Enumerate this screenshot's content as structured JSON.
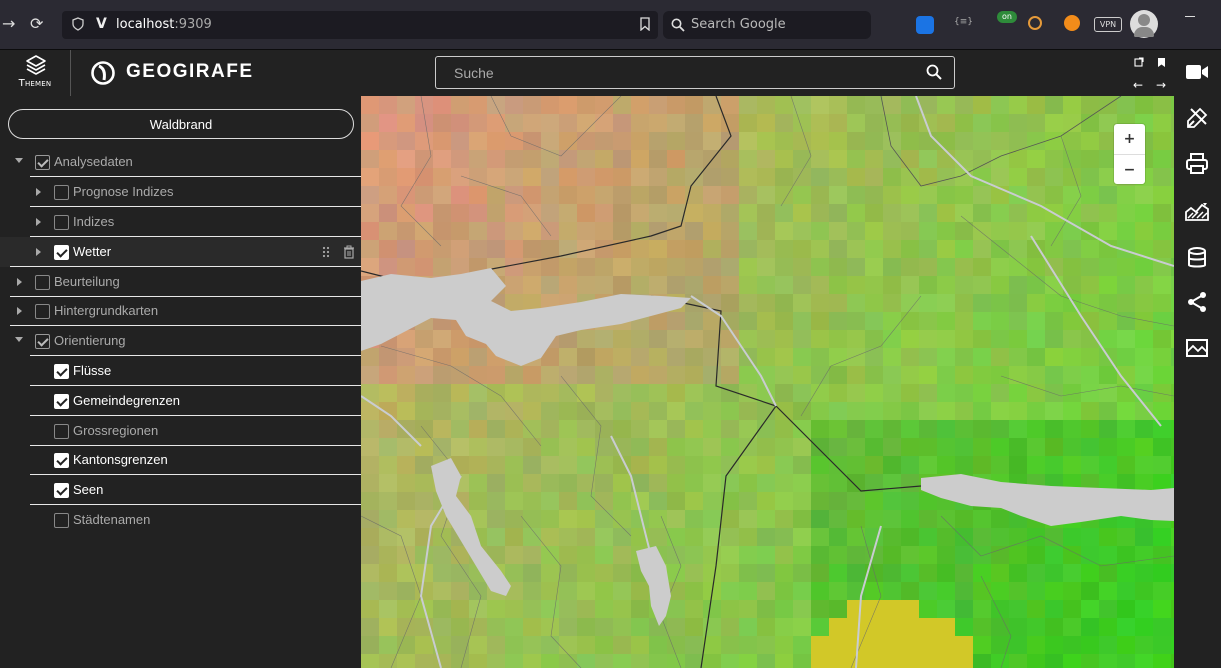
{
  "browser": {
    "url_host": "localhost",
    "url_port": ":9309",
    "search_placeholder": "Search Google",
    "ext_badge": "on",
    "ext_vpn": "VPN",
    "ext_code": "{≡}"
  },
  "header": {
    "themes_label": "Themen",
    "brand_name": "GEOGIRAFE",
    "search_placeholder": "Suche"
  },
  "sidebar": {
    "theme_button": "Waldbrand",
    "layers": [
      {
        "label": "Analysedaten"
      },
      {
        "label": "Prognose Indizes"
      },
      {
        "label": "Indizes"
      },
      {
        "label": "Wetter"
      },
      {
        "label": "Beurteilung"
      },
      {
        "label": "Hintergrundkarten"
      },
      {
        "label": "Orientierung"
      },
      {
        "label": "Flüsse"
      },
      {
        "label": "Gemeindegrenzen"
      },
      {
        "label": "Grossregionen"
      },
      {
        "label": "Kantonsgrenzen"
      },
      {
        "label": "Seen"
      },
      {
        "label": "Städtenamen"
      }
    ]
  },
  "map": {
    "zoom_in": "+",
    "zoom_out": "−"
  },
  "colors": {
    "accent": "#ffffff",
    "panel_bg": "#222222",
    "lake": "#cccccc"
  }
}
